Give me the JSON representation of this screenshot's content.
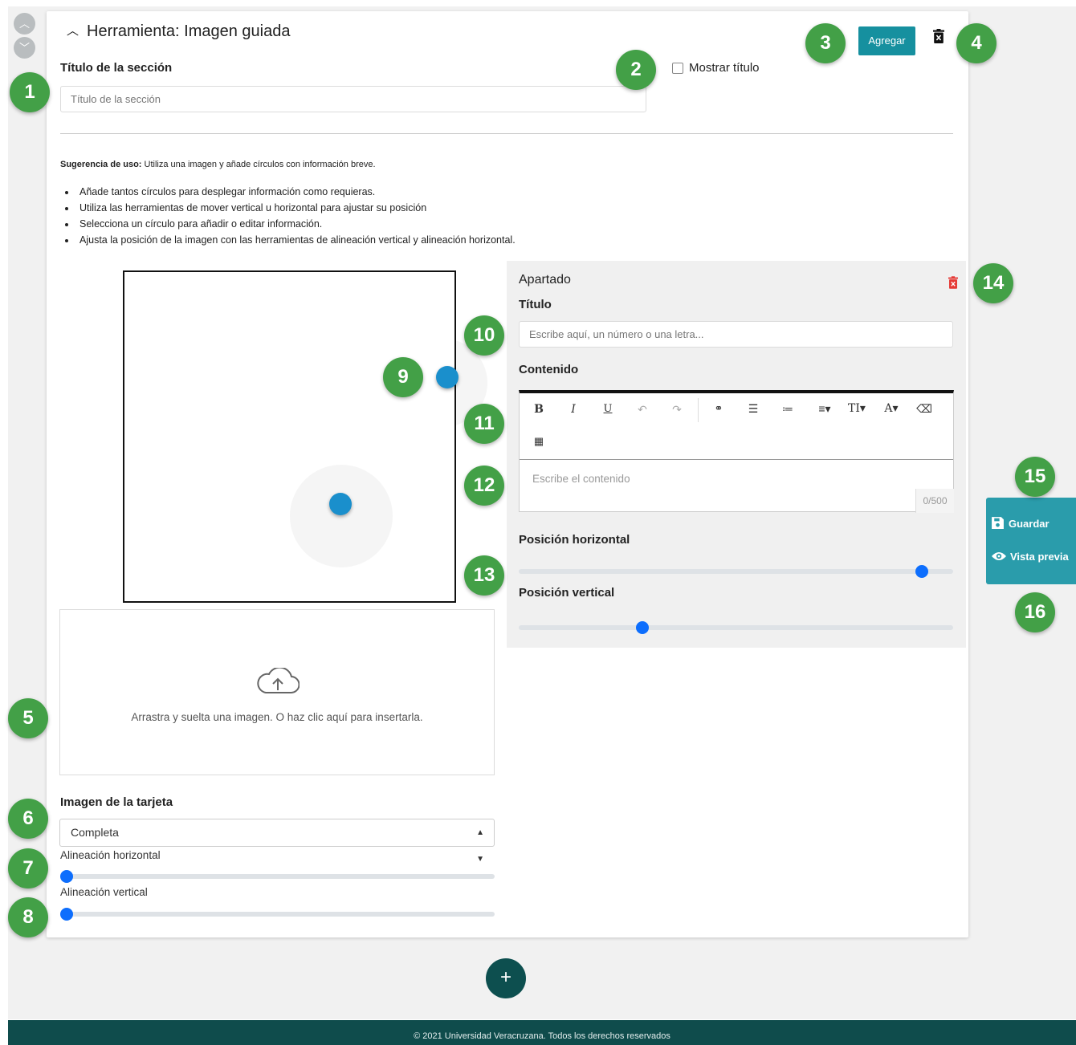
{
  "card": {
    "collapse_icon": "chevron-up-icon",
    "title": "Herramienta: Imagen guiada",
    "add_button": "Agregar",
    "delete_icon": "trash-icon"
  },
  "section": {
    "title_label": "Título de la sección",
    "title_placeholder": "Título de la sección",
    "show_title_label": "Mostrar título",
    "show_title_checked": false
  },
  "usage": {
    "label": "Sugerencia de uso:",
    "text": " Utiliza una imagen y añade círculos con información breve.",
    "bullets": [
      "Añade tantos círculos para desplegar información como requieras.",
      "Utiliza las herramientas de mover vertical u horizontal para ajustar su posición",
      "Selecciona un círculo para añadir o editar información.",
      "Ajusta la posición de la imagen con las herramientas de alineación vertical y alineación horizontal."
    ]
  },
  "upload": {
    "icon": "cloud-upload-icon",
    "text": "Arrastra y suelta una imagen. O haz clic aquí para insertarla."
  },
  "card_image": {
    "label": "Imagen de la tarjeta",
    "selected": "Completa",
    "h_align_label": "Alineación horizontal",
    "h_align_value": 0,
    "v_align_label": "Alineación vertical",
    "v_align_value": 0
  },
  "apartado": {
    "heading": "Apartado",
    "delete_icon": "trash-icon",
    "color_delete": "#e53935",
    "titulo_label": "Título",
    "titulo_placeholder": "Escribe aquí, un número o una letra...",
    "contenido_label": "Contenido",
    "toolbar": [
      "B",
      "I",
      "U",
      "↶",
      "↷",
      "🔗",
      "ordered-list-icon",
      "unordered-list-icon",
      "align-icon",
      "text-size-icon",
      "font-color-icon",
      "eraser-icon",
      "table-icon"
    ],
    "content_placeholder": "Escribe el contenido",
    "counter": "0/500",
    "pos_h_label": "Posición horizontal",
    "pos_h_value": 0.96,
    "pos_v_label": "Posición vertical",
    "pos_v_value": 0.28
  },
  "side_actions": {
    "save_label": "Guardar",
    "save_icon": "save-icon",
    "preview_label": "Vista previa",
    "preview_icon": "eye-icon"
  },
  "add_section_icon": "plus-icon",
  "footer": "© 2021 Universidad Veracruzana. Todos los derechos reservados",
  "badges": [
    "1",
    "2",
    "3",
    "4",
    "5",
    "6",
    "7",
    "8",
    "9",
    "10",
    "11",
    "12",
    "13",
    "14",
    "15",
    "16"
  ],
  "colors": {
    "accent": "#16909f",
    "badge": "#43a047",
    "footer": "#0f4c4c",
    "hotspot": "#1a8fcc",
    "slider": "#0d6efd"
  }
}
